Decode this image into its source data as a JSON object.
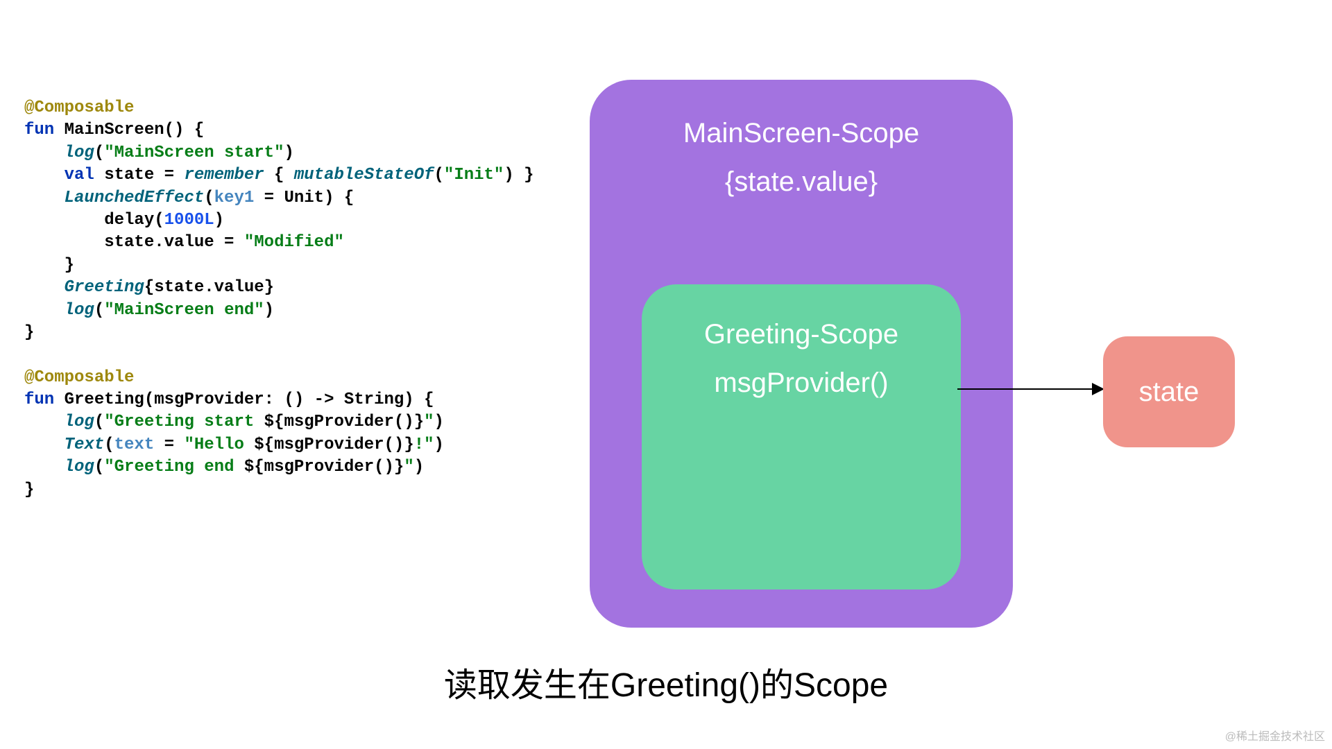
{
  "code": {
    "l1": "@Composable",
    "l2_kw": "fun ",
    "l2_fn": "MainScreen",
    "l2_rest": "() {",
    "l3a": "    ",
    "l3_log": "log",
    "l3_rest": "(",
    "l3_str": "\"MainScreen start\"",
    "l3_close": ")",
    "l4a": "    ",
    "l4_kw": "val ",
    "l4_var": "state = ",
    "l4_rem": "remember",
    "l4_mid": " { ",
    "l4_ms": "mutableStateOf",
    "l4_paren": "(",
    "l4_str": "\"Init\"",
    "l4_close": ") }",
    "l5a": "    ",
    "l5_le": "LaunchedEffect",
    "l5_paren": "(",
    "l5_key": "key1",
    "l5_eq": " = Unit) {",
    "l6a": "        delay(",
    "l6_num": "1000L",
    "l6_rest": ")",
    "l7a": "        state.value = ",
    "l7_str": "\"Modified\"",
    "l8": "    }",
    "l9a": "    ",
    "l9_fn": "Greeting",
    "l9_rest": "{state.value}",
    "l10a": "    ",
    "l10_log": "log",
    "l10_rest": "(",
    "l10_str": "\"MainScreen end\"",
    "l10_close": ")",
    "l11": "}",
    "l13": "@Composable",
    "l14_kw": "fun ",
    "l14_fn": "Greeting",
    "l14_rest": "(msgProvider: () -> String) {",
    "l15a": "    ",
    "l15_log": "log",
    "l15_rest": "(",
    "l15_str1": "\"Greeting start ",
    "l15_interp": "${msgProvider()}",
    "l15_str2": "\"",
    "l15_close": ")",
    "l16a": "    ",
    "l16_fn": "Text",
    "l16_paren": "(",
    "l16_param": "text",
    "l16_eq": " = ",
    "l16_str1": "\"Hello ",
    "l16_interp": "${msgProvider()}",
    "l16_str2": "!\"",
    "l16_close": ")",
    "l17a": "    ",
    "l17_log": "log",
    "l17_rest": "(",
    "l17_str1": "\"Greeting end ",
    "l17_interp": "${msgProvider()}",
    "l17_str2": "\"",
    "l17_close": ")",
    "l18": "}"
  },
  "diagram": {
    "mainscreen_title": "MainScreen-Scope",
    "mainscreen_subtitle": "{state.value}",
    "greeting_title": "Greeting-Scope",
    "greeting_subtitle": "msgProvider()",
    "state_label": "state"
  },
  "caption": "读取发生在Greeting()的Scope",
  "watermark": "@稀土掘金技术社区"
}
